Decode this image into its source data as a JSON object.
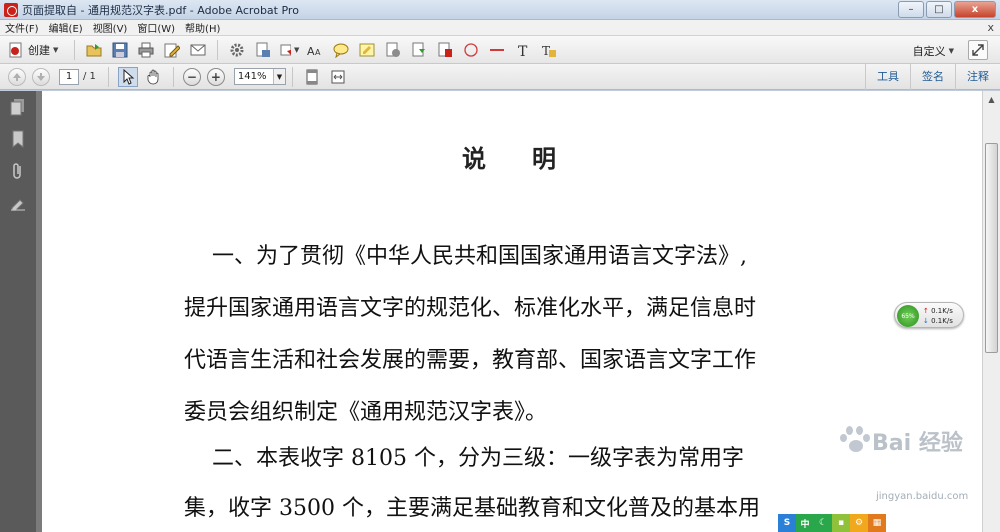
{
  "window": {
    "title": "页面提取自 - 通用规范汉字表.pdf - Adobe Acrobat Pro",
    "background_title": "",
    "min_label": "–",
    "max_label": "□",
    "close_label": "x"
  },
  "menu": {
    "items": [
      "文件(F)",
      "编辑(E)",
      "视图(V)",
      "窗口(W)",
      "帮助(H)"
    ],
    "close_doc": "x"
  },
  "toolbar": {
    "create_label": "创建",
    "customize_label": "自定义"
  },
  "nav": {
    "page_current": "1",
    "page_total": "/ 1",
    "zoom": "141%",
    "zoom_out": "−",
    "zoom_in": "+"
  },
  "panel_links": [
    "工具",
    "签名",
    "注释"
  ],
  "document": {
    "title": "说明",
    "lines": [
      "    一、为了贯彻《中华人民共和国国家通用语言文字法》,",
      "提升国家通用语言文字的规范化、标准化水平，满足信息时",
      "代语言生活和社会发展的需要，教育部、国家语言文字工作",
      "委员会组织制定《通用规范汉字表》。",
      "    二、本表收字 8105 个，分为三级：一级字表为常用字",
      "集，收字 3500 个，主要满足基础教育和文化普及的基本用"
    ]
  },
  "net_widget": {
    "percent": "65%",
    "up": "0.1K/s",
    "down": "0.1K/s"
  },
  "watermark": {
    "text": "Bai 经验",
    "url": "jingyan.baidu.com"
  },
  "tray": {
    "icons": [
      "S",
      "中",
      "☾",
      "▪",
      "⚙",
      "▦"
    ],
    "colors": [
      "#2a7fd6",
      "#2aa64b",
      "#2aa64b",
      "#8fc23a",
      "#f2a81d",
      "#e07a1c"
    ]
  },
  "colors": {
    "nav_panel": "#5a5a5a",
    "link": "#1f5b96"
  }
}
